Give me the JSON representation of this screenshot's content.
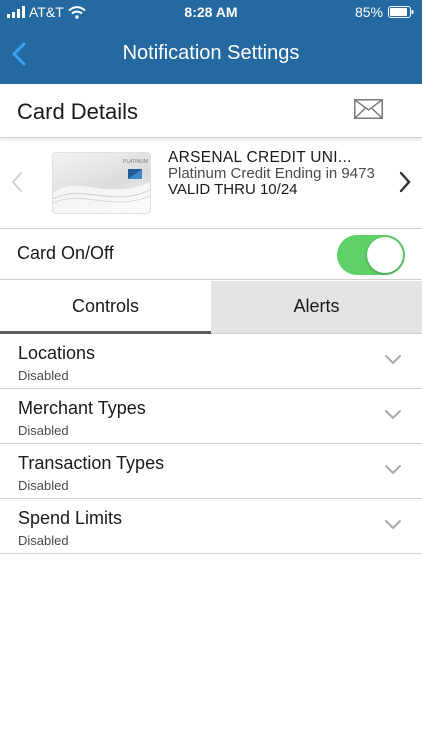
{
  "status_bar": {
    "carrier": "AT&T",
    "time": "8:28 AM",
    "battery": "85%"
  },
  "header": {
    "title": "Notification Settings"
  },
  "section": {
    "title": "Card Details"
  },
  "card": {
    "name": "ARSENAL CREDIT UNI...",
    "description": "Platinum Credit Ending in 9473",
    "valid_thru": "VALID THRU 10/24",
    "image_text": "PLATINUM"
  },
  "toggle": {
    "label": "Card On/Off",
    "on": true,
    "on_color": "#5fd168"
  },
  "tabs": [
    {
      "label": "Controls",
      "active": true
    },
    {
      "label": "Alerts",
      "active": false
    }
  ],
  "controls": [
    {
      "title": "Locations",
      "status": "Disabled"
    },
    {
      "title": "Merchant Types",
      "status": "Disabled"
    },
    {
      "title": "Transaction Types",
      "status": "Disabled"
    },
    {
      "title": "Spend Limits",
      "status": "Disabled"
    }
  ],
  "colors": {
    "header_bg": "#2469a1"
  }
}
